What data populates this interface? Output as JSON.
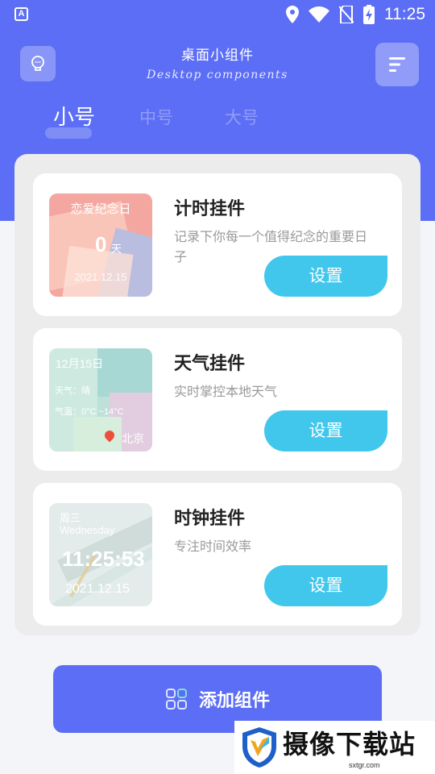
{
  "statusbar": {
    "app_icon": "A",
    "time": "11:25",
    "icons": [
      "location-icon",
      "wifi-icon",
      "no-sim-icon",
      "battery-charging-icon"
    ]
  },
  "header": {
    "title": "桌面小组件",
    "subtitle": "Desktop components"
  },
  "tabs": [
    {
      "label": "小号",
      "active": true
    },
    {
      "label": "中号",
      "active": false
    },
    {
      "label": "大号",
      "active": false
    }
  ],
  "widgets": [
    {
      "title": "计时挂件",
      "desc": "记录下你每一个值得纪念的重要日子",
      "button": "设置",
      "preview": {
        "label": "恋爱纪念日",
        "number": "0",
        "unit": "天",
        "date": "2021.12.15"
      }
    },
    {
      "title": "天气挂件",
      "desc": "实时掌控本地天气",
      "button": "设置",
      "preview": {
        "date": "12月15日",
        "weather": "天气：晴",
        "temp": "气温：0°C ~14°C",
        "city": "北京"
      }
    },
    {
      "title": "时钟挂件",
      "desc": "专注时间效率",
      "button": "设置",
      "preview": {
        "weekday": "周三",
        "weekday_en": "Wednesday",
        "time": "11:25:53",
        "date": "2021.12.15"
      }
    }
  ],
  "add_button": {
    "label": "添加组件"
  },
  "watermark": {
    "text": "摄像下载站",
    "url": "sxtgr.com"
  },
  "colors": {
    "primary": "#5c6ef5",
    "button": "#41c7ec",
    "background": "#f4f5f9"
  }
}
